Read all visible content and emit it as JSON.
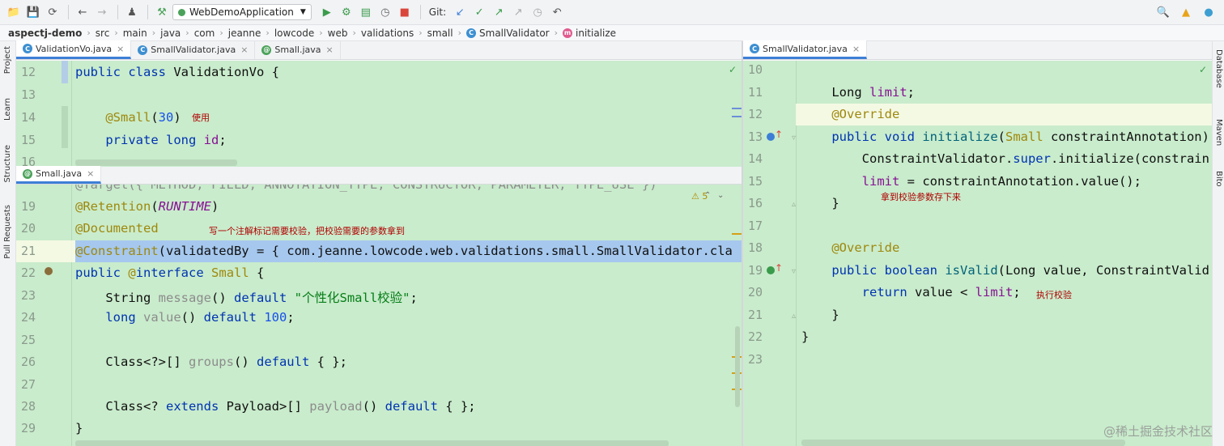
{
  "toolbar": {
    "run_config": "WebDemoApplication",
    "git_label": "Git:"
  },
  "breadcrumb": [
    "aspectj-demo",
    "src",
    "main",
    "java",
    "com",
    "jeanne",
    "lowcode",
    "web",
    "validations",
    "small",
    "SmallValidator",
    "initialize"
  ],
  "left_tool_windows": [
    "Project",
    "Learn",
    "Structure",
    "Pull Requests"
  ],
  "right_tool_windows": [
    "Database",
    "Maven",
    "Bito"
  ],
  "top_left_tabs": [
    {
      "label": "ValidationVo.java",
      "close": "×"
    },
    {
      "label": "SmallValidator.java",
      "close": "×"
    },
    {
      "label": "Small.java",
      "close": "×"
    }
  ],
  "bottom_left_tab": {
    "label": "Small.java",
    "close": "×"
  },
  "right_tab": {
    "label": "SmallValidator.java",
    "close": "×"
  },
  "editor1": {
    "line_numbers": [
      "12",
      "13",
      "14",
      "15",
      "16"
    ],
    "lines": [
      "public class ValidationVo {",
      "",
      "    @Small(30)",
      "    private long id;",
      ""
    ],
    "note": "使用"
  },
  "editor2": {
    "line_numbers": [
      "19",
      "20",
      "21",
      "22",
      "23",
      "24",
      "25",
      "26",
      "27",
      "28",
      "29"
    ],
    "partial_top": "@Target({ METHOD, FIELD, ANNOTATION_TYPE, CONSTRUCTOR, PARAMETER, TYPE_USE })",
    "lines": [
      "@Retention(RUNTIME)",
      "@Documented",
      "@Constraint(validatedBy = { com.jeanne.lowcode.web.validations.small.SmallValidator.cla",
      "public @interface Small {",
      "    String message() default \"个性化Small校验\";",
      "    long value() default 100;",
      "",
      "    Class<?>[] groups() default { };",
      "",
      "    Class<? extends Payload>[] payload() default { };",
      "}"
    ],
    "note": "写一个注解标记需要校验，把校验需要的参数拿到",
    "warnings": "5"
  },
  "editor3": {
    "line_numbers": [
      "10",
      "11",
      "12",
      "13",
      "14",
      "15",
      "16",
      "17",
      "18",
      "19",
      "20",
      "21",
      "22",
      "23"
    ],
    "lines": [
      "",
      "    Long limit;",
      "    @Override",
      "    public void initialize(Small constraintAnnotation)",
      "        ConstraintValidator.super.initialize(constrain",
      "        limit = constraintAnnotation.value();",
      "    }",
      "",
      "    @Override",
      "    public boolean isValid(Long value, ConstraintValid",
      "        return value < limit;",
      "    }",
      "}",
      ""
    ],
    "note1": "拿到校验参数存下来",
    "note2": "执行校验"
  },
  "watermark": "@稀土掘金技术社区"
}
